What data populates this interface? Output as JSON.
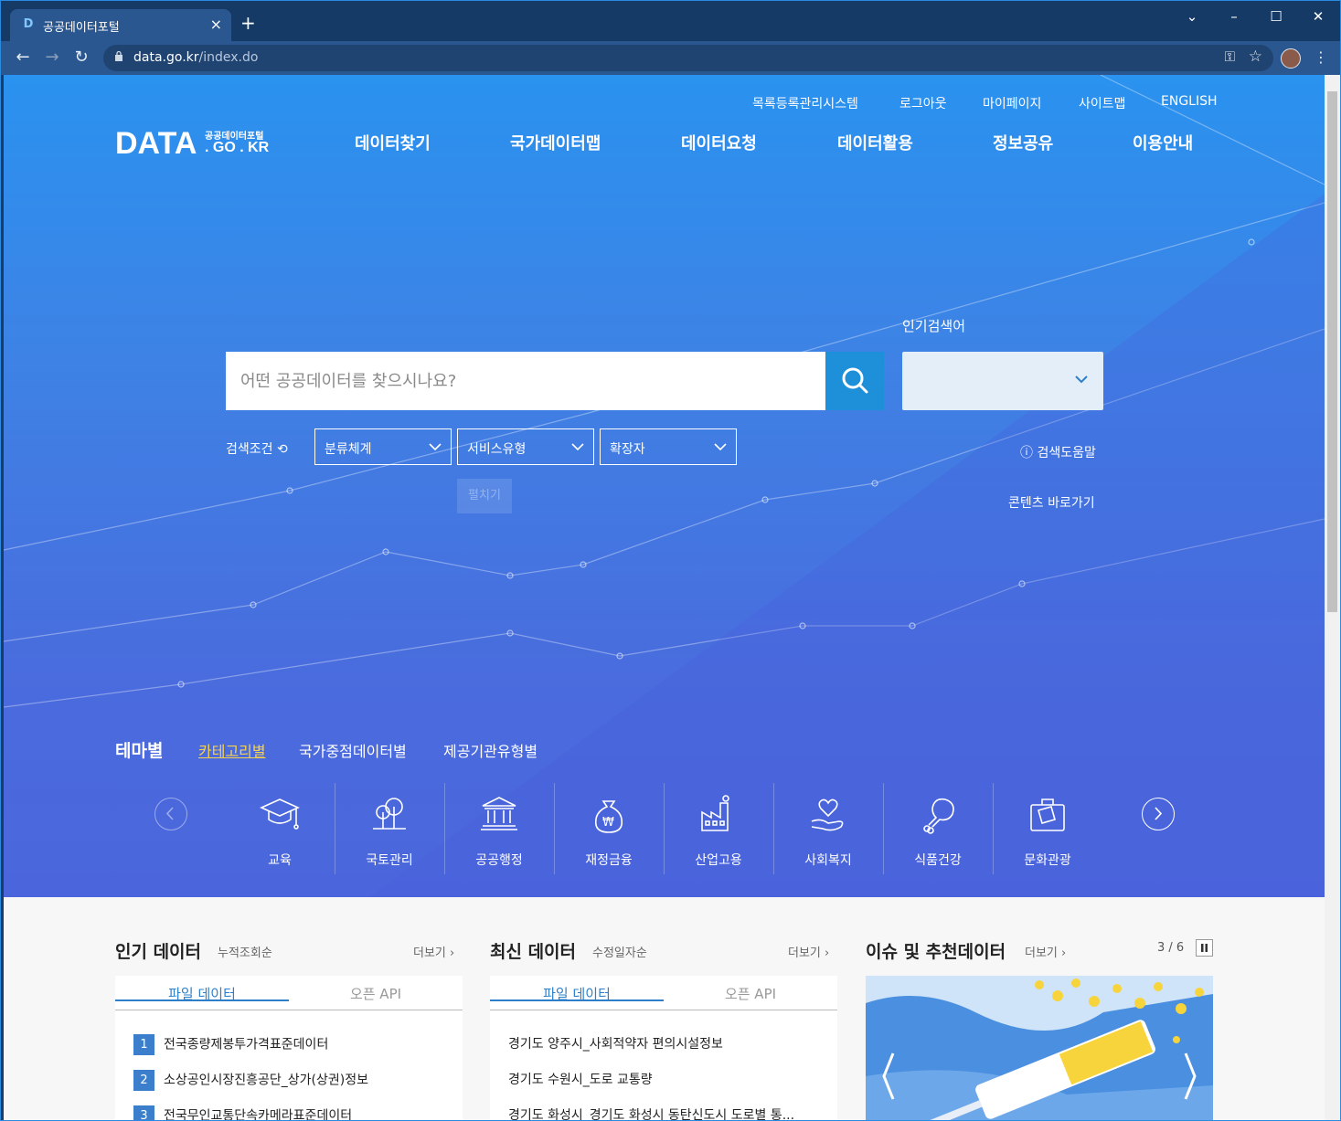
{
  "browser": {
    "tab_title": "공공데이터포털",
    "url_host": "data.go.kr",
    "url_path": "/index.do"
  },
  "top_links": [
    "목록등록관리시스템",
    "로그아웃",
    "마이페이지",
    "사이트맵",
    "ENGLISH"
  ],
  "logo": {
    "main": "DATA",
    "sub1": "공공데이터포털",
    "sub2": ". GO . KR"
  },
  "gnb": [
    "데이터찾기",
    "국가데이터맵",
    "데이터요청",
    "데이터활용",
    "정보공유",
    "이용안내"
  ],
  "search": {
    "placeholder": "어떤 공공데이터를 찾으시나요?",
    "popular_label": "인기검색어",
    "condition_label": "검색조건",
    "filters": [
      "분류체계",
      "서비스유형",
      "확장자"
    ],
    "fold_label": "펼치기",
    "help_label": "검색도움말",
    "contents_label": "콘텐츠 바로가기"
  },
  "theme_tabs": {
    "title": "테마별",
    "tabs": [
      "카테고리별",
      "국가중점데이터별",
      "제공기관유형별"
    ],
    "active": "카테고리별"
  },
  "categories": [
    {
      "label": "교육",
      "icon": "graduation-cap-icon"
    },
    {
      "label": "국토관리",
      "icon": "trees-icon"
    },
    {
      "label": "공공행정",
      "icon": "government-building-icon"
    },
    {
      "label": "재정금융",
      "icon": "money-bag-icon"
    },
    {
      "label": "산업고용",
      "icon": "factory-icon"
    },
    {
      "label": "사회복지",
      "icon": "heart-hand-icon"
    },
    {
      "label": "식품건강",
      "icon": "drumstick-icon"
    },
    {
      "label": "문화관광",
      "icon": "suitcase-icon"
    }
  ],
  "popular_data": {
    "title": "인기 데이터",
    "sub": "누적조회순",
    "more": "더보기",
    "tabs": [
      "파일 데이터",
      "오픈 API"
    ],
    "items": [
      "전국종량제봉투가격표준데이터",
      "소상공인시장진흥공단_상가(상권)정보",
      "전국무인교통단속카메라표준데이터"
    ]
  },
  "recent_data": {
    "title": "최신 데이터",
    "sub": "수정일자순",
    "more": "더보기",
    "tabs": [
      "파일 데이터",
      "오픈 API"
    ],
    "items": [
      "경기도 양주시_사회적약자 편의시설정보",
      "경기도 수원시_도로 교통량",
      "경기도 화성시_경기도 화성시 동탄신도시 도로별 통..."
    ]
  },
  "issue": {
    "title": "이슈 및 추천데이터",
    "more": "더보기",
    "pager": "3 / 6"
  },
  "colors": {
    "accent": "#2e7fc9",
    "hero_top": "#2a92ef",
    "hero_bottom": "#4b66dc",
    "active_tab": "#f6d24a"
  }
}
